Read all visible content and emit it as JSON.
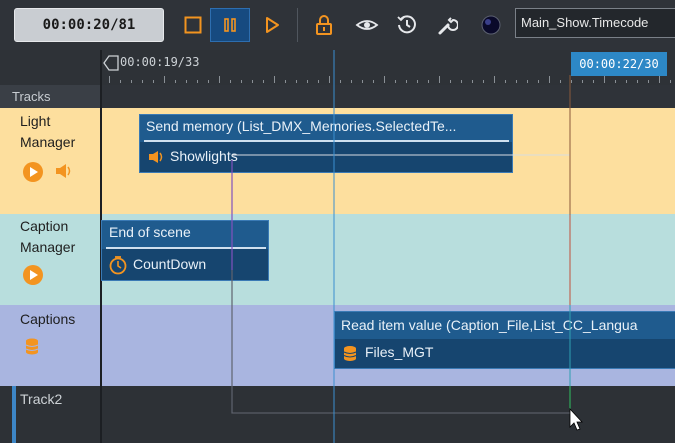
{
  "toolbar": {
    "timecode": "00:00:20/81",
    "show_name": "Main_Show.Timecode"
  },
  "ruler": {
    "start_time": "00:00:19/33",
    "end_time": "00:00:22/30"
  },
  "tracks_header": "Tracks",
  "tracks": [
    {
      "label": "Light Manager"
    },
    {
      "label": "Caption Manager"
    },
    {
      "label": "Captions"
    },
    {
      "label": "Track2"
    }
  ],
  "blocks": [
    {
      "title": "Send memory (List_DMX_Memories.SelectedTe...",
      "subtitle": "Showlights"
    },
    {
      "title": "End of scene",
      "subtitle": "CountDown"
    },
    {
      "title": "Read item value (Caption_File,List_CC_Langua",
      "subtitle": "Files_MGT"
    }
  ],
  "colors": {
    "accent": "#2d88c6",
    "orange": "#f39420",
    "light_lane": "#fddf9e",
    "caption_lane": "#b8dedd",
    "captions_lane": "#a9b5e0",
    "block": "#1f5b8e"
  }
}
